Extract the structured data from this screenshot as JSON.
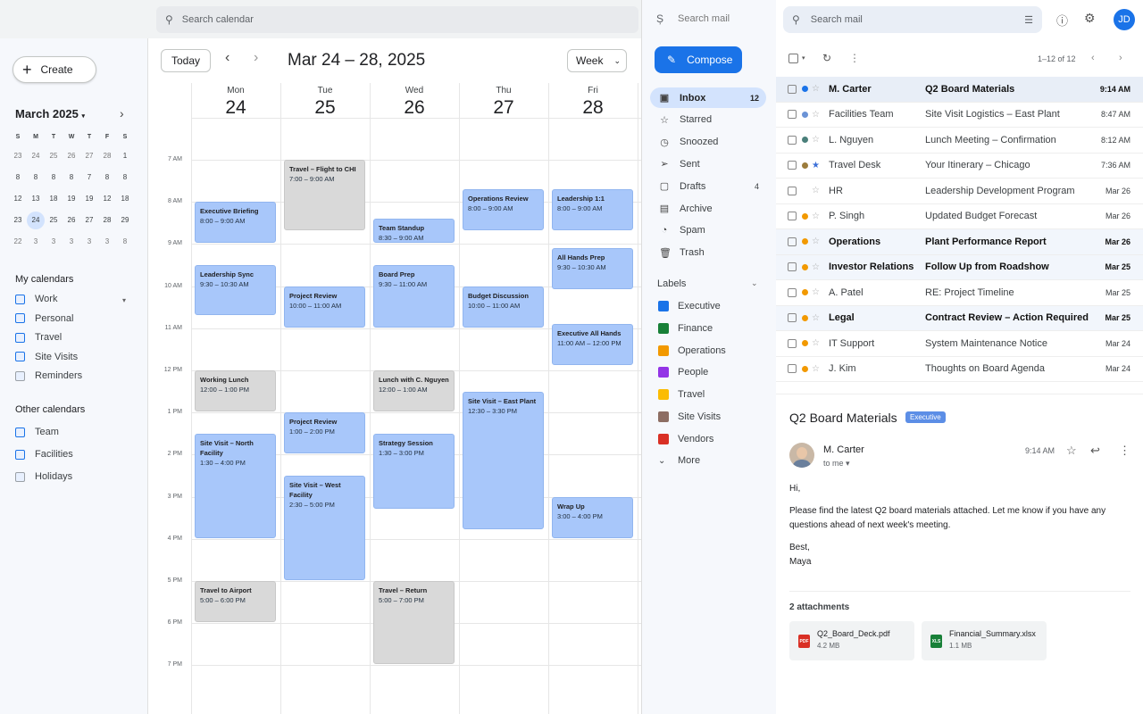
{
  "calendar": {
    "search_placeholder": "Search calendar",
    "create_label": "Create",
    "mini": {
      "title": "March 2025",
      "weekday_headers": [
        "S",
        "M",
        "T",
        "W",
        "T",
        "F",
        "S"
      ],
      "weeks": [
        [
          "23",
          "24",
          "25",
          "26",
          "27",
          "28",
          "1"
        ],
        [
          "8",
          "8",
          "8",
          "8",
          "7",
          "8",
          "8"
        ],
        [
          "12",
          "13",
          "18",
          "19",
          "19",
          "12",
          "18"
        ],
        [
          "23",
          "24",
          "25",
          "26",
          "27",
          "28",
          "29"
        ],
        [
          "22",
          "3",
          "3",
          "3",
          "3",
          "3",
          "8"
        ]
      ],
      "selected": "24"
    },
    "my_calendars_title": "My calendars",
    "my_calendars": [
      "Work",
      "Personal",
      "Travel",
      "Site Visits",
      "Reminders"
    ],
    "other_calendars_title": "Other calendars",
    "other_calendars": [
      "Team",
      "Facilities",
      "Holidays"
    ],
    "today_label": "Today",
    "range": "Mar 24 – 28, 2025",
    "view_label": "Week",
    "days": [
      {
        "name": "Mon",
        "date": "24"
      },
      {
        "name": "Tue",
        "date": "25"
      },
      {
        "name": "Wed",
        "date": "26"
      },
      {
        "name": "Thu",
        "date": "27"
      },
      {
        "name": "Fri",
        "date": "28"
      }
    ],
    "time_labels": [
      "7 AM",
      "8 AM",
      "9 AM",
      "10 AM",
      "11 AM",
      "12 PM",
      "1 PM",
      "2 PM",
      "3 PM",
      "4 PM",
      "5 PM",
      "6 PM",
      "7 PM"
    ],
    "events": [
      {
        "day": 0,
        "title": "Executive Briefing",
        "time": "8:00 – 9:00 AM",
        "start": 8.0,
        "end": 9.0,
        "color": "blue"
      },
      {
        "day": 0,
        "title": "Leadership Sync",
        "time": "9:30 – 10:30 AM",
        "start": 9.5,
        "end": 10.7,
        "color": "blue"
      },
      {
        "day": 0,
        "title": "Working Lunch",
        "time": "12:00 – 1:00 PM",
        "start": 12.0,
        "end": 13.0,
        "color": "gray"
      },
      {
        "day": 0,
        "title": "Site Visit – North Facility",
        "time": "1:30 – 4:00 PM",
        "start": 13.5,
        "end": 16.0,
        "color": "blue"
      },
      {
        "day": 0,
        "title": "Travel to Airport",
        "time": "5:00 – 6:00 PM",
        "start": 17.0,
        "end": 18.0,
        "color": "gray"
      },
      {
        "day": 1,
        "title": "Travel – Flight to CHI",
        "time": "7:00 – 9:00 AM",
        "start": 7.0,
        "end": 8.7,
        "color": "gray"
      },
      {
        "day": 1,
        "title": "Project Review",
        "time": "10:00 – 11:00 AM",
        "start": 10.0,
        "end": 11.0,
        "color": "blue"
      },
      {
        "day": 1,
        "title": "Project Review",
        "time": "1:00 – 2:00 PM",
        "start": 13.0,
        "end": 14.0,
        "color": "blue"
      },
      {
        "day": 1,
        "title": "Site Visit – West Facility",
        "time": "2:30 – 5:00 PM",
        "start": 14.5,
        "end": 17.0,
        "color": "blue"
      },
      {
        "day": 2,
        "title": "Team Standup",
        "time": "8:30 – 9:00 AM",
        "start": 8.4,
        "end": 9.0,
        "color": "blue"
      },
      {
        "day": 2,
        "title": "Board Prep",
        "time": "9:30 – 11:00 AM",
        "start": 9.5,
        "end": 11.0,
        "color": "blue"
      },
      {
        "day": 2,
        "title": "Lunch with C. Nguyen",
        "time": "12:00 – 1:00 AM",
        "start": 12.0,
        "end": 13.0,
        "color": "gray"
      },
      {
        "day": 2,
        "title": "Strategy Session",
        "time": "1:30 – 3:00 PM",
        "start": 13.5,
        "end": 15.3,
        "color": "blue"
      },
      {
        "day": 2,
        "title": "Travel – Return",
        "time": "5:00 – 7:00 PM",
        "start": 17.0,
        "end": 19.0,
        "color": "gray"
      },
      {
        "day": 3,
        "title": "Operations Review",
        "time": "8:00 – 9:00 AM",
        "start": 7.7,
        "end": 8.7,
        "color": "blue"
      },
      {
        "day": 3,
        "title": "Budget Discussion",
        "time": "10:00 – 11:00 AM",
        "start": 10.0,
        "end": 11.0,
        "color": "blue"
      },
      {
        "day": 3,
        "title": "Site Visit – East Plant",
        "time": "12:30 – 3:30 PM",
        "start": 12.5,
        "end": 15.8,
        "color": "blue"
      },
      {
        "day": 4,
        "title": "Leadership 1:1",
        "time": "8:00 – 9:00 AM",
        "start": 7.7,
        "end": 8.7,
        "color": "blue"
      },
      {
        "day": 4,
        "title": "All Hands Prep",
        "time": "9:30 – 10:30 AM",
        "start": 9.1,
        "end": 10.1,
        "color": "blue"
      },
      {
        "day": 4,
        "title": "Executive All Hands",
        "time": "11:00 AM – 12:00 PM",
        "start": 10.9,
        "end": 11.9,
        "color": "blue"
      },
      {
        "day": 4,
        "title": "Wrap Up",
        "time": "3:00 – 4:00 PM",
        "start": 15.0,
        "end": 16.0,
        "color": "blue"
      }
    ]
  },
  "mail": {
    "search_label": "Search mail",
    "search_placeholder": "Search mail",
    "compose_label": "Compose",
    "nav": [
      {
        "label": "Inbox",
        "icon": "inbox-icon",
        "glyph": "▣",
        "count": "12",
        "active": true
      },
      {
        "label": "Starred",
        "icon": "star-icon",
        "glyph": "☆",
        "count": "",
        "active": false
      },
      {
        "label": "Snoozed",
        "icon": "clock-icon",
        "glyph": "◷",
        "count": "",
        "active": false
      },
      {
        "label": "Sent",
        "icon": "send-icon",
        "glyph": "➢",
        "count": "",
        "active": false
      },
      {
        "label": "Drafts",
        "icon": "draft-icon",
        "glyph": "▢",
        "count": "4",
        "active": false
      },
      {
        "label": "Archive",
        "icon": "archive-icon",
        "glyph": "▤",
        "count": "",
        "active": false
      },
      {
        "label": "Spam",
        "icon": "spam-icon",
        "glyph": "◔",
        "count": "",
        "active": false
      },
      {
        "label": "Trash",
        "icon": "trash-icon",
        "glyph": "🗑",
        "count": "",
        "active": false
      }
    ],
    "labels_title": "Labels",
    "labels": [
      {
        "name": "Executive",
        "color": "#1a73e8"
      },
      {
        "name": "Finance",
        "color": "#188038"
      },
      {
        "name": "Operations",
        "color": "#f29900"
      },
      {
        "name": "People",
        "color": "#9334e6"
      },
      {
        "name": "Travel",
        "color": "#fbbc04"
      },
      {
        "name": "Site Visits",
        "color": "#8d6e63"
      },
      {
        "name": "Vendors",
        "color": "#d93025"
      }
    ],
    "more_label": "More",
    "pagination": "1–12 of 12",
    "messages": [
      {
        "sender": "M. Carter",
        "subject": "Q2 Board Materials",
        "time": "9:14 AM",
        "dot": "#1a73e8",
        "starred": false,
        "unread": true
      },
      {
        "sender": "Facilities Team",
        "subject": "Site Visit Logistics – East Plant",
        "time": "8:47 AM",
        "dot": "#6b93d6",
        "starred": false,
        "unread": false
      },
      {
        "sender": "L. Nguyen",
        "subject": "Lunch Meeting – Confirmation",
        "time": "8:12 AM",
        "dot": "#4a7f7a",
        "starred": false,
        "unread": false
      },
      {
        "sender": "Travel Desk",
        "subject": "Your Itinerary – Chicago",
        "time": "7:36 AM",
        "dot": "#9c7c3c",
        "starred": true,
        "unread": false
      },
      {
        "sender": "HR",
        "subject": "Leadership Development Program",
        "time": "Mar 26",
        "dot": "",
        "starred": false,
        "unread": false
      },
      {
        "sender": "P. Singh",
        "subject": "Updated Budget Forecast",
        "time": "Mar 26",
        "dot": "#f29900",
        "starred": false,
        "unread": false
      },
      {
        "sender": "Operations",
        "subject": "Plant Performance Report",
        "time": "Mar 26",
        "dot": "#f29900",
        "starred": false,
        "unread": true
      },
      {
        "sender": "Investor Relations",
        "subject": "Follow Up from Roadshow",
        "time": "Mar 25",
        "dot": "#f29900",
        "starred": false,
        "unread": true
      },
      {
        "sender": "A. Patel",
        "subject": "RE: Project Timeline",
        "time": "Mar 25",
        "dot": "#f29900",
        "starred": false,
        "unread": false
      },
      {
        "sender": "Legal",
        "subject": "Contract Review – Action Required",
        "time": "Mar 25",
        "dot": "#f29900",
        "starred": false,
        "unread": true
      },
      {
        "sender": "IT Support",
        "subject": "System Maintenance Notice",
        "time": "Mar 24",
        "dot": "#f29900",
        "starred": false,
        "unread": false
      },
      {
        "sender": "J. Kim",
        "subject": "Thoughts on Board Agenda",
        "time": "Mar 24",
        "dot": "#f29900",
        "starred": false,
        "unread": false
      }
    ],
    "reader": {
      "subject": "Q2 Board Materials",
      "badge": "Executive",
      "from": "M. Carter",
      "to": "to me",
      "time": "9:14 AM",
      "greeting": "Hi,",
      "body": "Please find the latest Q2 board materials attached. Let me know if you have any questions ahead of next week's meeting.",
      "signoff": "Best,",
      "signature": "Maya",
      "attachments_title": "2 attachments",
      "attachments": [
        {
          "name": "Q2_Board_Deck.pdf",
          "size": "4.2 MB",
          "type": "PDF",
          "color": "#d93025"
        },
        {
          "name": "Financial_Summary.xlsx",
          "size": "1.1 MB",
          "type": "XLS",
          "color": "#188038"
        }
      ]
    },
    "avatar_initials": "JD"
  }
}
